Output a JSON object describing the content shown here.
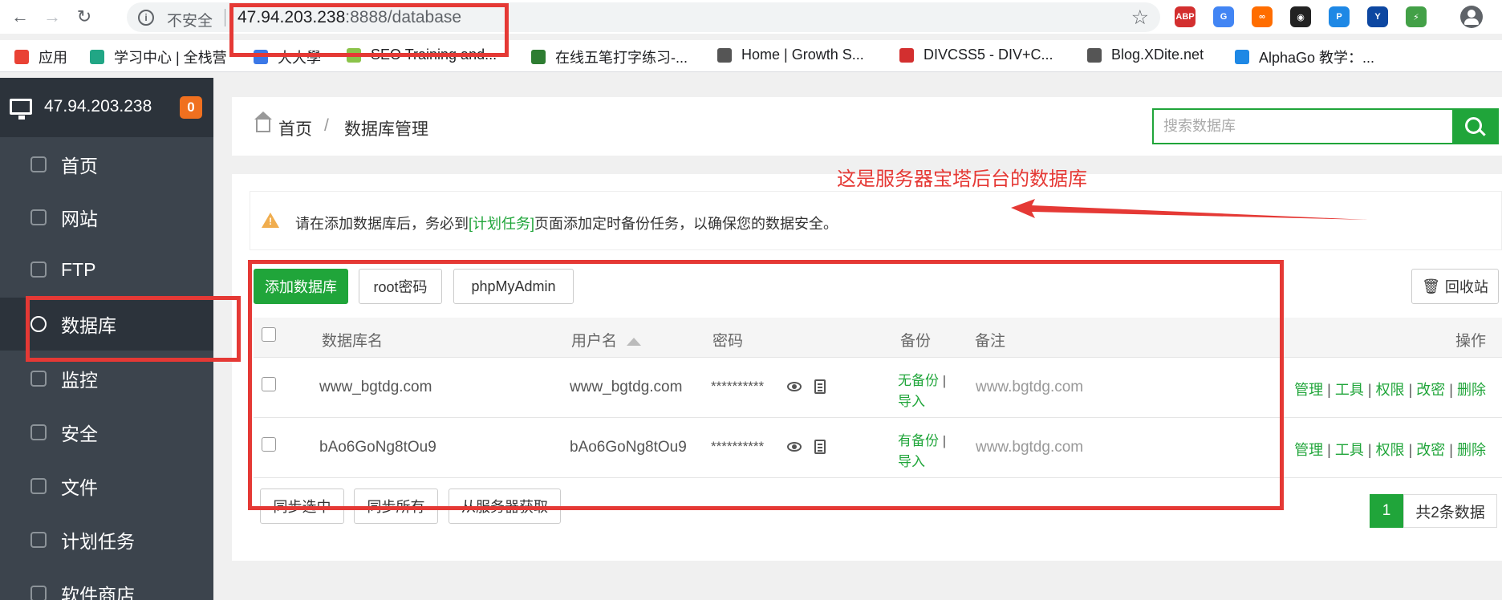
{
  "browser": {
    "security_label": "不安全",
    "url_host": "47.94.203.238",
    "url_rest": ":8888/database",
    "extensions": [
      {
        "name": "abp-icon",
        "label": "ABP",
        "color": "#d32f2f"
      },
      {
        "name": "translate-icon",
        "label": "G",
        "color": "#4285f4"
      },
      {
        "name": "infinity-icon",
        "label": "∞",
        "color": "#ff6d00"
      },
      {
        "name": "mask-icon",
        "label": "◉",
        "color": "#222222"
      },
      {
        "name": "p-icon",
        "label": "P",
        "color": "#1e88e5"
      },
      {
        "name": "y-icon",
        "label": "Y",
        "color": "#0d47a1"
      },
      {
        "name": "bolt-icon",
        "label": "⚡",
        "color": "#43a047"
      }
    ]
  },
  "bookmarks": [
    {
      "label": "应用",
      "icon": "apps-icon",
      "color": "#e94235"
    },
    {
      "label": "学习中心 | 全栈营",
      "icon": "learn-icon",
      "color": "#21a685"
    },
    {
      "label": "大大學",
      "icon": "school-icon",
      "color": "#3b78e7"
    },
    {
      "label": "SEO Training and...",
      "icon": "seo-icon",
      "color": "#8bc34a"
    },
    {
      "label": "在线五笔打字练习-...",
      "icon": "typing-icon",
      "color": "#2e7d32"
    },
    {
      "label": "Home | Growth S...",
      "icon": "globe-icon",
      "color": "#555555"
    },
    {
      "label": "DIVCSS5 - DIV+C...",
      "icon": "divcss-icon",
      "color": "#d32f2f"
    },
    {
      "label": "Blog.XDite.net",
      "icon": "globe-icon",
      "color": "#555555"
    },
    {
      "label": "AlphaGo 教学：...",
      "icon": "alphago-icon",
      "color": "#1e88e5"
    }
  ],
  "sidebar": {
    "server_ip": "47.94.203.238",
    "badge": "0",
    "items": [
      {
        "label": "首页",
        "icon": "home-icon"
      },
      {
        "label": "网站",
        "icon": "globe-icon"
      },
      {
        "label": "FTP",
        "icon": "ftp-icon"
      },
      {
        "label": "数据库",
        "icon": "database-icon",
        "active": true
      },
      {
        "label": "监控",
        "icon": "monitor-icon"
      },
      {
        "label": "安全",
        "icon": "shield-icon"
      },
      {
        "label": "文件",
        "icon": "folder-icon"
      },
      {
        "label": "计划任务",
        "icon": "calendar-icon"
      },
      {
        "label": "软件商店",
        "icon": "store-icon"
      }
    ]
  },
  "breadcrumb": {
    "home": "首页",
    "separator": "/",
    "current": "数据库管理"
  },
  "search": {
    "placeholder": "搜索数据库"
  },
  "alert": {
    "before": "请在添加数据库后，务必到",
    "link": "[计划任务]",
    "after": "页面添加定时备份任务，以确保您的数据安全。"
  },
  "toolbar": {
    "add": "添加数据库",
    "root_password": "root密码",
    "phpmyadmin": "phpMyAdmin",
    "recycle": "回收站"
  },
  "table": {
    "headers": {
      "name": "数据库名",
      "user": "用户名",
      "password": "密码",
      "backup": "备份",
      "note": "备注",
      "actions": "操作"
    },
    "rows": [
      {
        "name": "www_bgtdg.com",
        "user": "www_bgtdg.com",
        "password": "**********",
        "backup_status": "无备份",
        "backup_sep": "|",
        "import": "导入",
        "note": "www.bgtdg.com"
      },
      {
        "name": "bAo6GoNg8tOu9",
        "user": "bAo6GoNg8tOu9",
        "password": "**********",
        "backup_status": "有备份",
        "backup_sep": "|",
        "import": "导入",
        "note": "www.bgtdg.com"
      }
    ],
    "actions": [
      "管理",
      "工具",
      "权限",
      "改密",
      "删除"
    ],
    "action_sep": "|"
  },
  "footer": {
    "sync_selected": "同步选中",
    "sync_all": "同步所有",
    "fetch_server": "从服务器获取"
  },
  "pagination": {
    "page": "1",
    "total": "共2条数据"
  },
  "annotation": {
    "text": "这是服务器宝塔后台的数据库",
    "color": "#e53935"
  }
}
